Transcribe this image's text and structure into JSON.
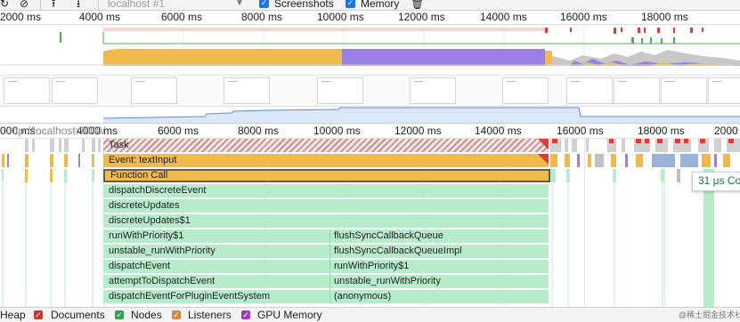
{
  "toolbar": {
    "url": "localhost #1",
    "screenshots_label": "Screenshots",
    "memory_label": "Memory",
    "reload_icon": "reload-icon",
    "clear_icon": "clear-icon",
    "upload_icon": "upload-icon",
    "download_icon": "download-icon",
    "gc_icon": "trash-icon"
  },
  "overview_ruler": [
    "2000 ms",
    "4000 ms",
    "6000 ms",
    "8000 ms",
    "10000 ms",
    "12000 ms",
    "14000 ms",
    "16000 ms",
    "18000 ms"
  ],
  "main_ruler": [
    "000 ms",
    "4000 ms",
    "6000 ms",
    "8000 ms",
    "10000 ms",
    "12000 ms",
    "14000 ms",
    "16000 ms",
    "18000 ms",
    "2000"
  ],
  "main_url": "ttp://localhost:3000/",
  "flame": {
    "task": "Task",
    "event": "Event: textInput",
    "function_call": "Function Call",
    "left_stack": [
      "dispatchDiscreteEvent",
      "discreteUpdates",
      "discreteUpdates$1",
      "runWithPriority$1",
      "unstable_runWithPriority",
      "dispatchEvent",
      "attemptToDispatchEvent",
      "dispatchEventForPluginEventSystem"
    ],
    "right_stack": [
      "flushSyncCallbackQueue",
      "flushSyncCallbackQueueImpl",
      "runWithPriority$1",
      "unstable_runWithPriority",
      "(anonymous)"
    ]
  },
  "tooltip": "31 µs Co",
  "legend": {
    "heap": "Heap",
    "documents": "Documents",
    "nodes": "Nodes",
    "listeners": "Listeners",
    "gpu_memory": "GPU Memory",
    "colors": {
      "documents": "#c0392b",
      "nodes": "#2ea44f",
      "listeners": "#d4883c",
      "gpu_memory": "#a03cb8"
    }
  },
  "watermark": "@稀土掘金技术社区",
  "colors": {
    "scripting": "#f0b94c",
    "rendering": "#9b7fe6",
    "function_green": "#b7eccb",
    "long_task": "#e53935"
  }
}
